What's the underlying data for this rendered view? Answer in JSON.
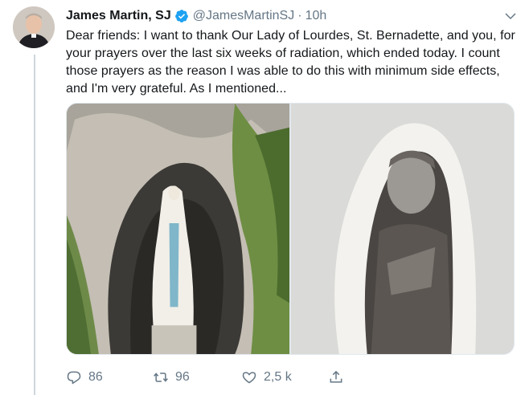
{
  "tweet": {
    "author_name": "James Martin, SJ",
    "handle": "@JamesMartinSJ",
    "separator": "·",
    "time": "10h",
    "text": "Dear friends: I want to thank Our Lady of Lourdes, St. Bernadette, and you, for your prayers over the last six weeks of radiation, which ended today. I count those prayers as the reason I was able to do this with minimum side effects, and I'm very grateful. As I mentioned...",
    "verified": true
  },
  "media": {
    "photos": [
      {
        "subject": "grotto-statue"
      },
      {
        "subject": "bernadette-portrait"
      }
    ]
  },
  "actions": {
    "reply_count": "86",
    "retweet_count": "96",
    "like_count": "2,5 k"
  },
  "colors": {
    "text": "#14171a",
    "secondary": "#657786",
    "verified": "#1da1f2",
    "thread_line": "#ccd6dd"
  },
  "icons": [
    "verified-badge-icon",
    "chevron-down-icon",
    "reply-icon",
    "retweet-icon",
    "like-icon",
    "share-icon"
  ]
}
